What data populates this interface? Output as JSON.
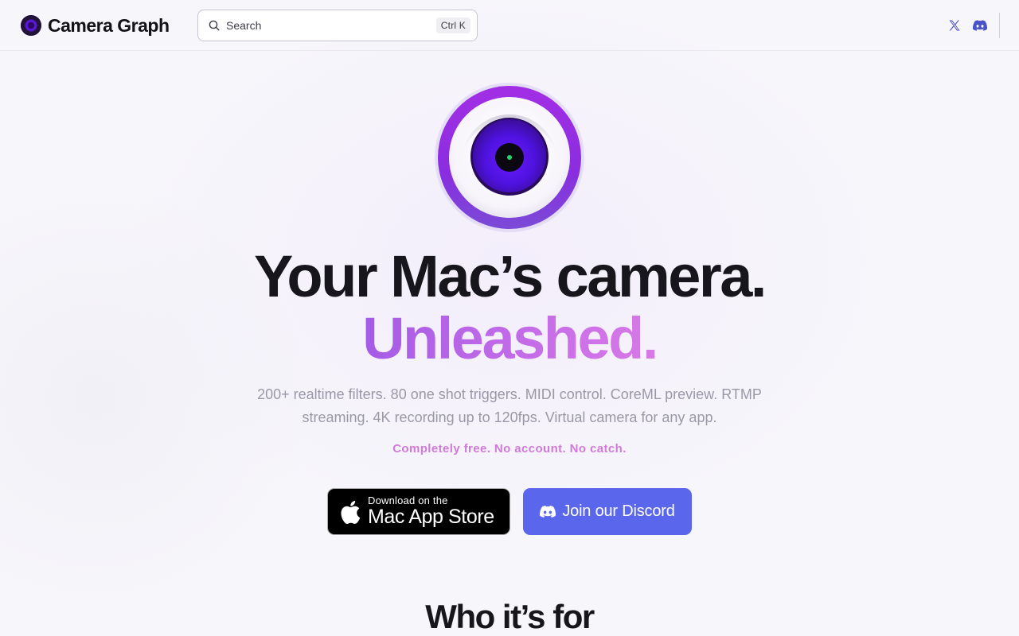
{
  "header": {
    "brand_name": "Camera Graph",
    "search": {
      "placeholder": "Search",
      "shortcut": "Ctrl K"
    },
    "social": [
      {
        "icon": "x-icon",
        "label": "X"
      },
      {
        "icon": "discord-icon",
        "label": "Discord"
      }
    ]
  },
  "hero": {
    "headline_line1": "Your Mac’s camera.",
    "headline_line2": "Unleashed.",
    "subtitle": "200+ realtime filters. 80 one shot triggers. MIDI control. CoreML preview. RTMP streaming. 4K recording up to 120fps. Virtual camera for any app.",
    "tagline": "Completely free. No account. No catch.",
    "app_store": {
      "small_label": "Download on the",
      "big_label": "Mac App Store",
      "icon": "apple-icon"
    },
    "discord": {
      "label": "Join our Discord",
      "icon": "discord-icon"
    }
  },
  "sections": {
    "who_title": "Who it’s for"
  },
  "colors": {
    "accent_purple": "#a45be6",
    "tagline_pink": "#d07ad8",
    "discord_blue": "#5a66ec",
    "dark_text": "#16161c"
  }
}
